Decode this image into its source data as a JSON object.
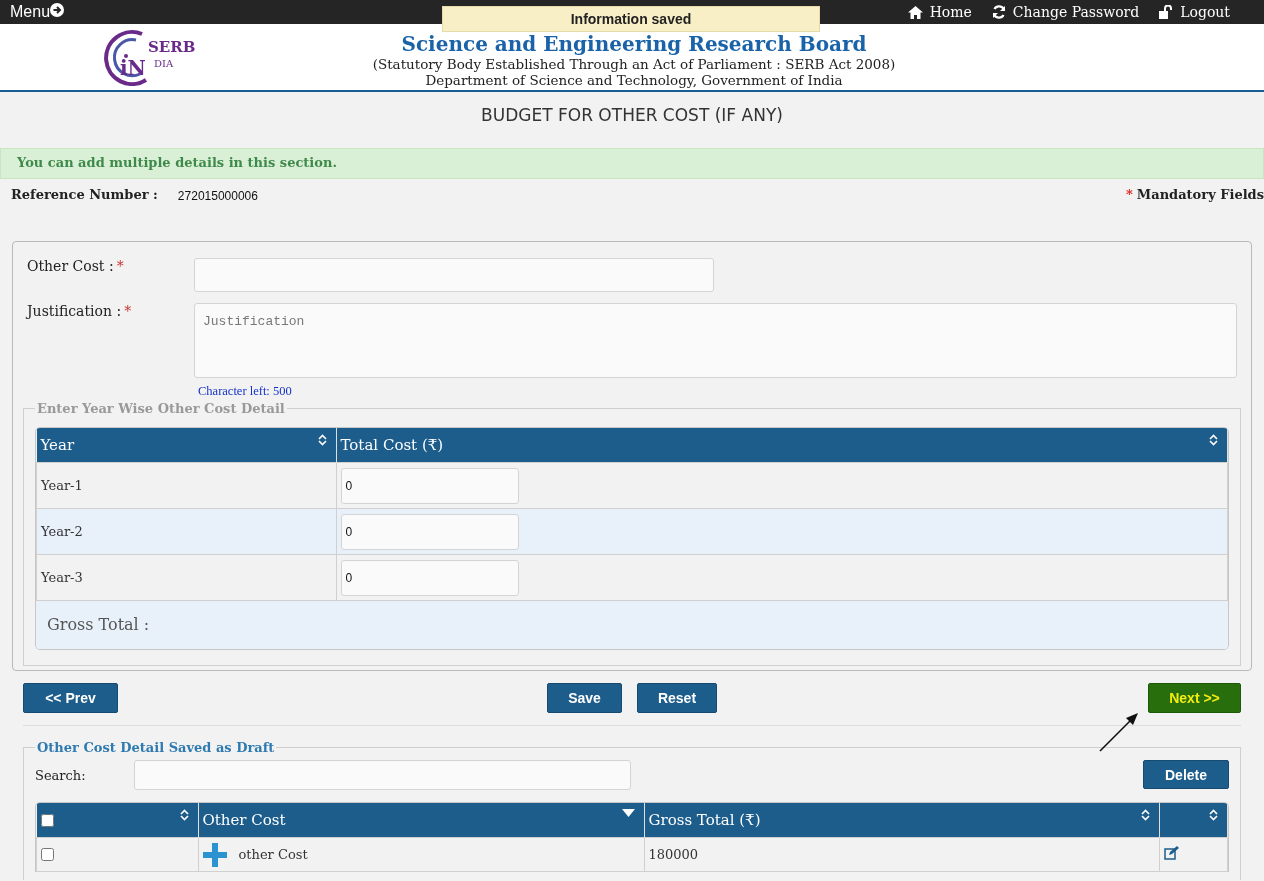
{
  "top_bar": {
    "menu": "Menu",
    "links": [
      {
        "kind": "home",
        "label": "Home"
      },
      {
        "kind": "refresh",
        "label": "Change Password"
      },
      {
        "kind": "lock",
        "label": "Logout"
      }
    ]
  },
  "toast": "Information saved",
  "header": {
    "logo": {
      "letters": "iN",
      "name": "SERB",
      "sub": "DIA"
    },
    "title": "Science and Engineering Research Board",
    "subtitle": "(Statutory Body Established Through an Act of Parliament : SERB Act 2008)",
    "department": "Department of Science and Technology, Government of India"
  },
  "page_title": "BUDGET FOR OTHER COST (IF ANY)",
  "alert": "You can add multiple details in this section.",
  "reference": {
    "label": "Reference Number :",
    "value": "272015000006"
  },
  "mandatory": {
    "mark": "*",
    "label": "Mandatory Fields"
  },
  "form": {
    "other_cost": {
      "label": "Other Cost :",
      "mark": "*"
    },
    "justification": {
      "label": "Justification :",
      "mark": "*",
      "placeholder": "Justification"
    },
    "char_left": "Character left: 500"
  },
  "year_section": {
    "legend": "Enter Year Wise Other Cost Detail",
    "columns": [
      {
        "label": "Year",
        "sorted": false
      },
      {
        "label": "Total Cost (₹)",
        "sorted": false
      }
    ],
    "rows": [
      {
        "year": "Year-1",
        "value": "0"
      },
      {
        "year": "Year-2",
        "value": "0"
      },
      {
        "year": "Year-3",
        "value": "0"
      }
    ],
    "gross_total": "Gross Total :"
  },
  "buttons": {
    "prev": "<< Prev",
    "save": "Save",
    "reset": "Reset",
    "next": "Next >>"
  },
  "draft": {
    "legend": "Other Cost Detail Saved as Draft",
    "search_label": "Search:",
    "delete": "Delete",
    "select_all": {
      "checked": false
    },
    "columns": [
      {
        "kind": "checkbox",
        "sorted": false
      },
      {
        "kind": "text",
        "label": "Other Cost",
        "sorted": true
      },
      {
        "kind": "text",
        "label": "Gross Total (₹)",
        "sorted": false
      },
      {
        "kind": "action",
        "sorted": false
      }
    ],
    "rows": [
      {
        "checked": false,
        "other_cost": "other Cost",
        "gross_total": "180000"
      }
    ]
  }
}
